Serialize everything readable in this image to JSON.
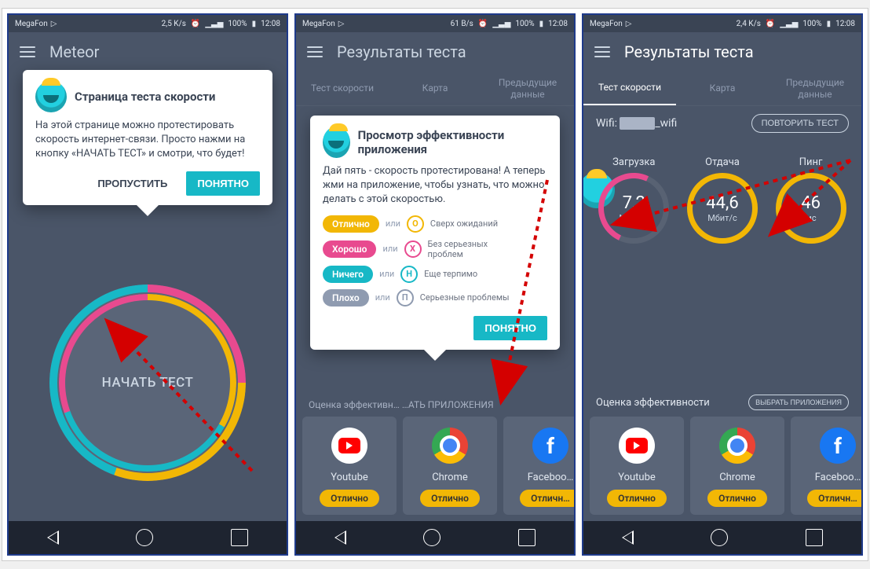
{
  "status": {
    "carrier": "MegaFon",
    "speed1": "2,5 K/s",
    "speed2": "61 B/s",
    "speed3": "2,4 K/s",
    "battery": "100%",
    "time": "12:08"
  },
  "screen1": {
    "appTitle": "Meteor",
    "tooltip": {
      "title": "Страница теста скорости",
      "body": "На этой странице можно протестировать скорость интернет-связи. Просто нажми на кнопку «НАЧАТЬ ТЕСТ» и смотри, что будет!",
      "skip": "ПРОПУСТИТЬ",
      "ok": "ПОНЯТНО"
    },
    "startTest": "НАЧАТЬ ТЕСТ"
  },
  "screen2": {
    "appTitle": "Результаты теста",
    "tabs": {
      "t1": "Тест скорости",
      "t2": "Карта",
      "t3": "Предыдущие данные"
    },
    "tooltip": {
      "title": "Просмотр эффективности приложения",
      "body": "Дай пять - скорость протестирована! А теперь жми на приложение, чтобы узнать, что можно делать с этой скоростью.",
      "ok": "ПОНЯТНО",
      "ili": "или",
      "rows": [
        {
          "pill": "Отлично",
          "letter": "О",
          "desc": "Сверх ожиданий"
        },
        {
          "pill": "Хорошо",
          "letter": "Х",
          "desc": "Без серьезных проблем"
        },
        {
          "pill": "Ничего",
          "letter": "Н",
          "desc": "Еще терпимо"
        },
        {
          "pill": "Плохо",
          "letter": "П",
          "desc": "Серьезные проблемы"
        }
      ]
    },
    "sectionHint": "Оценка эффективн…   …АТЬ ПРИЛОЖЕНИЯ"
  },
  "screen3": {
    "appTitle": "Результаты теста",
    "tabs": {
      "t1": "Тест скорости",
      "t2": "Карта",
      "t3": "Предыдущие данные"
    },
    "wifi": {
      "label": "Wifi:",
      "name": "_wifi",
      "retest": "ПОВТОРИТЬ ТЕСТ"
    },
    "metrics": {
      "download": {
        "title": "Загрузка",
        "value": "7,2",
        "unit": "Мбит/с"
      },
      "upload": {
        "title": "Отдача",
        "value": "44,6",
        "unit": "Мбит/с"
      },
      "ping": {
        "title": "Пинг",
        "value": "46",
        "unit": "мс"
      }
    },
    "sectionTitle": "Оценка эффективности",
    "sectionBtn": "ВЫБРАТЬ ПРИЛОЖЕНИЯ"
  },
  "apps": [
    {
      "name": "Youtube",
      "badge": "Отлично"
    },
    {
      "name": "Chrome",
      "badge": "Отлично"
    },
    {
      "name": "Faceboo…",
      "badge": "Отличн…"
    }
  ]
}
